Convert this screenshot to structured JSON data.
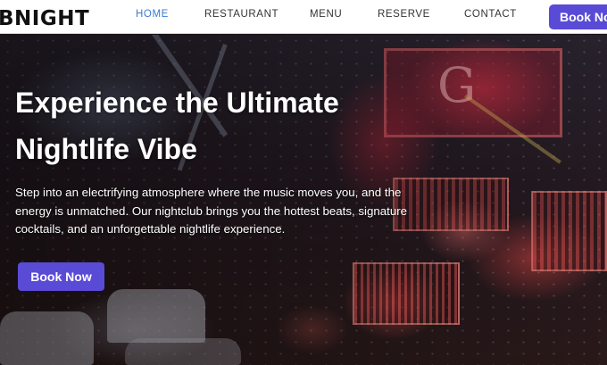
{
  "brand": {
    "name": "BNIGHT"
  },
  "nav": {
    "items": [
      {
        "label": "HOME",
        "active": true
      },
      {
        "label": "RESTAURANT",
        "active": false
      },
      {
        "label": "MENU",
        "active": false
      },
      {
        "label": "RESERVE",
        "active": false
      },
      {
        "label": "CONTACT",
        "active": false
      }
    ],
    "cta_label": "Book Now"
  },
  "hero": {
    "title": "Experience the Ultimate Nightlife Vibe",
    "description": "Step into an electrifying atmosphere where the music moves you, and the energy is unmatched. Our nightclub brings you the hottest beats, signature cocktails, and an unforgettable nightlife experience.",
    "cta_label": "Book Now"
  },
  "colors": {
    "accent": "#5a4bd6",
    "nav_active": "#3a7bd5"
  }
}
